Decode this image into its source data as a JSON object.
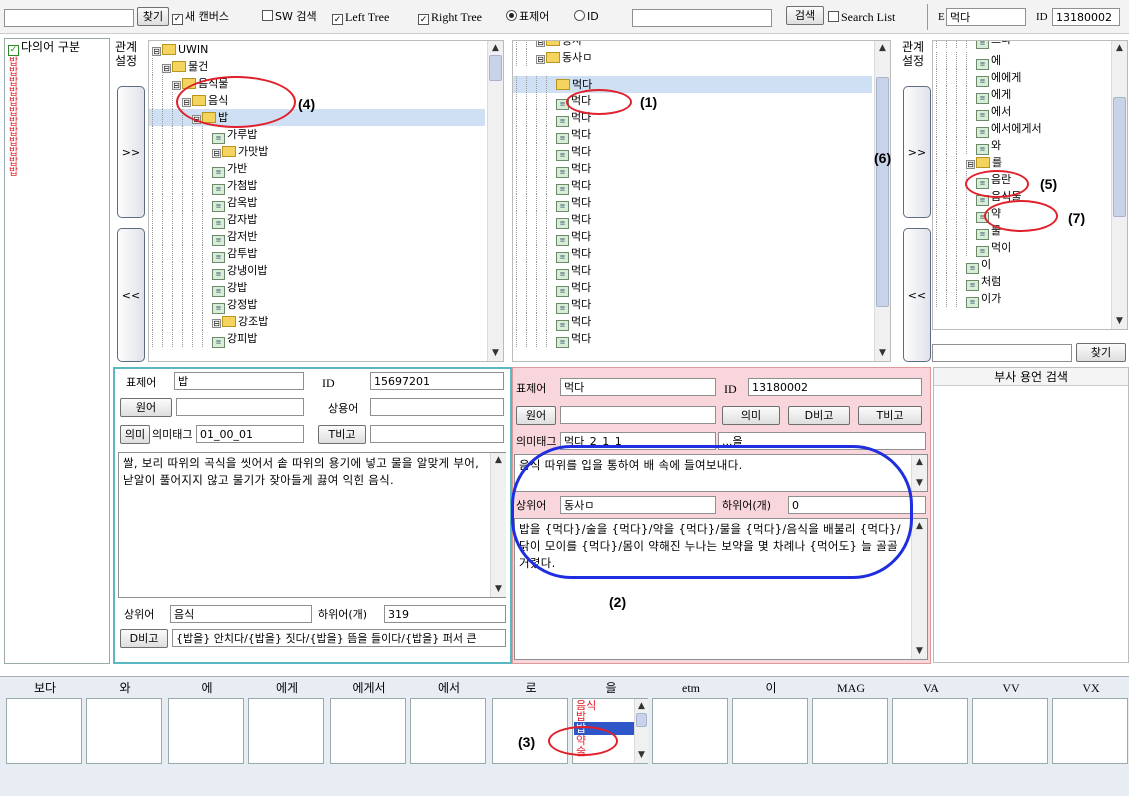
{
  "toolbar": {
    "find_label": "찾기",
    "new_canvas": "새 캔버스",
    "sw_search": "SW 검색",
    "left_tree": "Left Tree",
    "right_tree": "Right Tree",
    "headword": "표제어",
    "id_label": "ID",
    "search_label": "검색",
    "search_list": "Search List",
    "e_label": "E",
    "e_value": "먹다",
    "id_value": "13180002"
  },
  "left": {
    "polysemy_label": "다의어 구분",
    "red_items": [
      "밥",
      "밥",
      "밥",
      "밥",
      "밥",
      "밥",
      "밥",
      "밥",
      "밥",
      "밥",
      "밥",
      "밥"
    ]
  },
  "relation_label": "관계\n설정",
  "move_right": ">>",
  "move_left": "<<",
  "tree_left": {
    "rows": [
      "UWIN",
      "물건",
      "음식물",
      "음식",
      "밥",
      "가루밥",
      "가맛밥",
      "가반",
      "가첨밥",
      "감옥밥",
      "감자밥",
      "감저반",
      "감투밥",
      "강냉이밥",
      "강밥",
      "강정밥",
      "강조밥",
      "강피밥"
    ]
  },
  "tree_mid": {
    "rows": [
      "동사",
      "동사ㅁ",
      "먹다",
      "먹다",
      "먹다",
      "먹다",
      "먹다",
      "먹다",
      "먹다",
      "먹다",
      "먹다",
      "먹다",
      "먹다",
      "먹다",
      "먹다",
      "먹다",
      "먹다",
      "먹다"
    ]
  },
  "tree_right": {
    "rows": [
      "으다",
      "에",
      "에에게",
      "에게",
      "에서",
      "에서에게서",
      "와",
      "를",
      "음란",
      "음식물",
      "약",
      "물",
      "먹이",
      "이",
      "처럼",
      "이가"
    ]
  },
  "right_find": "찾기",
  "adverb_title": "부사 용언 검색",
  "entry_left": {
    "headword_label": "표제어",
    "headword": "밥",
    "id_label": "ID",
    "id": "15697201",
    "source_label": "원어",
    "source": "",
    "common_label": "상용어",
    "common": "",
    "sense_btn": "의미",
    "sense_tag_label": "의미태그",
    "sense_tag": "01_00_01",
    "t_btn": "T비고",
    "t_val": "",
    "definition": "쌀, 보리 따위의 곡식을 씻어서 솥 따위의 용기에 넣고 물을 알맞게 부어, 낟알이 풀어지지 않고 물기가 잦아들게 끓여 익힌 음식.",
    "hyper_label": "상위어",
    "hyper": "음식",
    "hypo_label": "하위어(개)",
    "hypo": "319",
    "d_btn": "D비고",
    "d_val": "{밥을} 안치다/{밥을} 짓다/{밥을} 뜸을 들이다/{밥을} 퍼서 큰"
  },
  "entry_right": {
    "headword_label": "표제어",
    "headword": "먹다",
    "id_label": "ID",
    "id": "13180002",
    "source_label": "원어",
    "source": "",
    "sense_btn": "의미",
    "d_btn": "D비고",
    "t_btn": "T비고",
    "sense_tag_label": "의미태그",
    "sense_tag": "먹다_2_1_1",
    "tag2": "...을",
    "definition": "음식 따위를 입을 통하여 배 속에 들여보내다.",
    "hyper_label": "상위어",
    "hyper": "동사ㅁ",
    "hypo_label": "하위어(개)",
    "hypo": "0",
    "examples": "밥을 {먹다}/술을 {먹다}/약을 {먹다}/물을 {먹다}/음식을 배불리 {먹다}/닭이 모이를 {먹다}/몸이 약해진 누나는 보약을 몇 차례나 {먹어도} 늘 골골거렸다."
  },
  "bottom": {
    "columns": [
      "보다",
      "와",
      "에",
      "에게",
      "에게서",
      "에서",
      "로",
      "을",
      "etm",
      "이",
      "MAG",
      "VA",
      "VV",
      "VX"
    ],
    "eul_list": [
      "음식",
      "밥",
      "밥",
      "약",
      "술"
    ]
  },
  "annotations": [
    "(1)",
    "(2)",
    "(3)",
    "(4)",
    "(5)",
    "(6)",
    "(7)"
  ],
  "colors": {
    "accent_red": "#e0202a",
    "annotation_blue": "#1f2fe0",
    "pink_panel": "#f8d6dc",
    "cyan_border": "#5ab8c0"
  }
}
